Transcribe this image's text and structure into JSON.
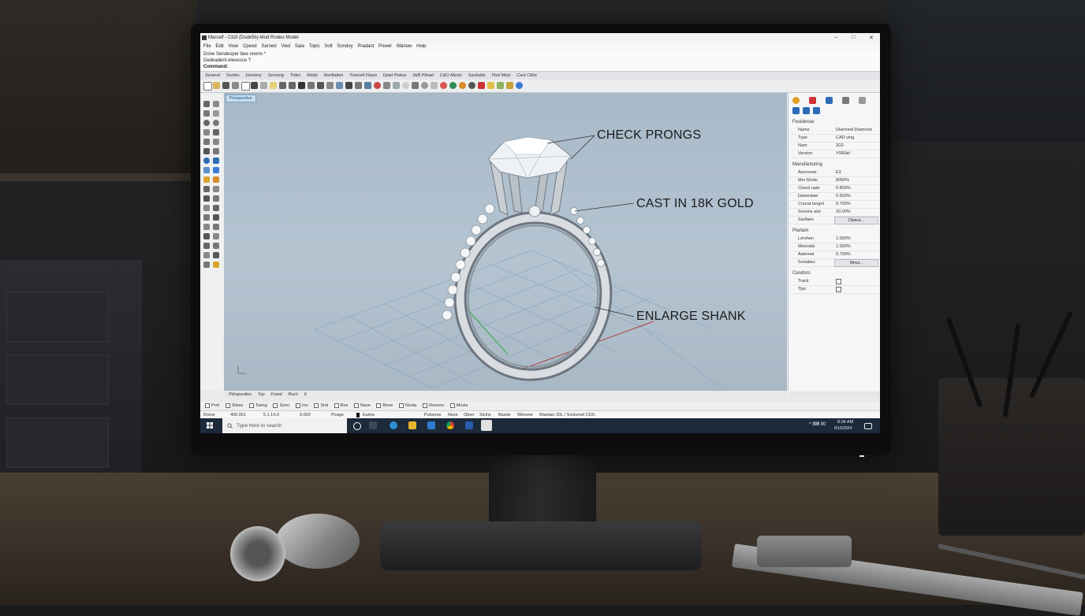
{
  "window": {
    "title": "Marcelf - Cb2l (Dsde5b)-Mod Rodeo Model",
    "minimize": "–",
    "maximize": "□",
    "close": "✕"
  },
  "menu": [
    "File",
    "Edit",
    "View",
    "Cpeod",
    "Sarned",
    "Vied",
    "Sala",
    "Topic",
    "Solt",
    "Sondoy",
    "Pradant",
    "Power",
    "Wanow",
    "Help"
  ],
  "command": {
    "line1": "Done Sendesper bee onono *",
    "line2": "Dedeadent elesooce ?",
    "prompt": "Command:"
  },
  "ribbon_tabs": [
    "Suneral",
    "Sonfes",
    "Dontony",
    "Semong",
    "Trdes",
    "Modo",
    "Nonfiation",
    "Trancell Flaws",
    "Dpiel Pokoo",
    "SkB Plinad",
    "C&O Mests",
    "Sasitalds",
    "Fbol Metz",
    "Cast Clbla"
  ],
  "viewport": {
    "label": "Perspective",
    "callout1": "CHECK PRONGS",
    "callout2": "CAST IN 18K GOLD",
    "callout3": "ENLARGE SHANK"
  },
  "properties": {
    "section1": "Fesidesse",
    "rows1": [
      {
        "label": "Name",
        "value": "Diamond Diamond"
      },
      {
        "label": "Type",
        "value": "CAD ving"
      },
      {
        "label": "Nam",
        "value": "2D2"
      },
      {
        "label": "Version",
        "value": "Y0R0el"
      }
    ],
    "section2": "Manufacturing",
    "rows2": [
      {
        "label": "Aarnoose",
        "value": "E3"
      },
      {
        "label": "Mer Mode",
        "value": "8050%"
      },
      {
        "label": "Cloesl uate",
        "value": "0.800%"
      },
      {
        "label": "Daoerdaer",
        "value": "5.600%"
      },
      {
        "label": "Cnurat langnt",
        "value": "0.700%"
      },
      {
        "label": "Snoons alst",
        "value": "20.00%"
      },
      {
        "label": "Sarllaes",
        "value": "Dlance..."
      }
    ],
    "section3": "Plarlam",
    "rows3": [
      {
        "label": "Lorshen",
        "value": "1.000%"
      },
      {
        "label": "Meeodal",
        "value": "1.000%"
      },
      {
        "label": "Aatoned",
        "value": "0.700%"
      },
      {
        "label": "Soriabes",
        "value": "Meca..."
      }
    ],
    "section4": "Cendors",
    "rows4": [
      {
        "label": "Track",
        "value": ""
      },
      {
        "label": "Tips",
        "value": ""
      }
    ]
  },
  "view_tabs": [
    "Pdrspeotles",
    "Top",
    "Frand",
    "Rsch",
    "6"
  ],
  "osnap": [
    "Prnt",
    "Srbes",
    "Toeng",
    "Sonn",
    "Ino",
    "Snd",
    "Box",
    "Nave",
    "Bone",
    "Nsota",
    "Reonns",
    "Mosie"
  ],
  "status": {
    "s1": "Rome",
    "s2": "400.001",
    "s3": "5.1 14.0",
    "s4": "0.000",
    "s5": "Poage",
    "s6": "Eaims",
    "s7": "Pulooms",
    "s8": "Nexe",
    "s9": "Oben",
    "s10": "Siclns",
    "s11": "Baxde",
    "s12": "Wiinene",
    "s13": "Maxdan 20L / Sockenel CD0."
  },
  "taskbar": {
    "search_placeholder": "Type here to search",
    "tray_text": "^ ⌨ 80",
    "time": "8:34 AM",
    "date": "6/16/2024"
  }
}
